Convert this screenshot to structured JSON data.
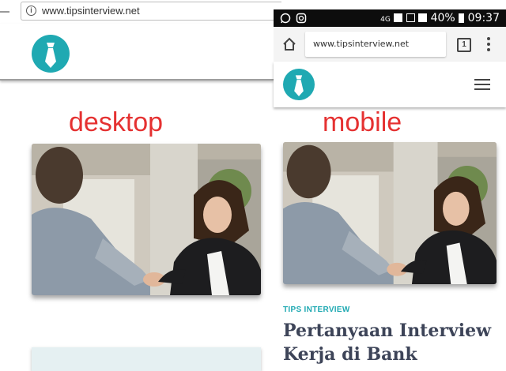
{
  "desktop": {
    "url": "www.tipsinterview.net",
    "label": "desktop"
  },
  "mobile": {
    "label": "mobile",
    "status": {
      "signal": "4G",
      "battery": "40%",
      "time": "09:37"
    },
    "url": "www.tipsinterview.net",
    "tab_count": "1",
    "category": "TIPS INTERVIEW",
    "article_title": "Pertanyaan Interview Kerja di Bank"
  },
  "colors": {
    "accent": "#1fa9b2",
    "label": "#e53131",
    "title": "#3d4458"
  },
  "icons": [
    "info-icon",
    "tie-logo-icon",
    "whatsapp-icon",
    "instagram-icon",
    "home-icon",
    "tabs-icon",
    "menu-dots-icon",
    "hamburger-icon"
  ]
}
